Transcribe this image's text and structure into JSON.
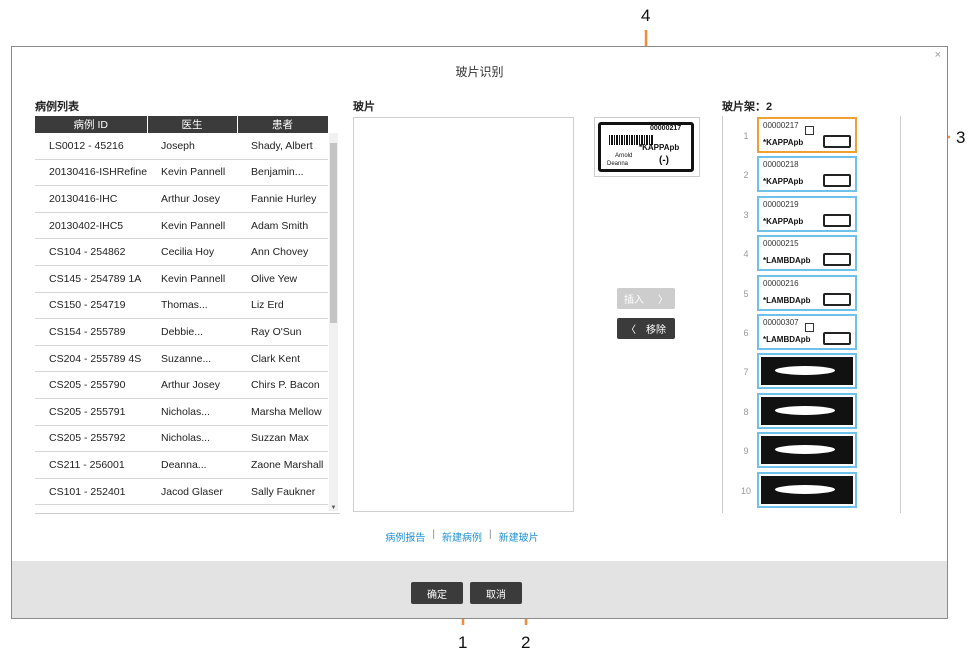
{
  "dialog": {
    "title": "玻片识别",
    "close": "×"
  },
  "case_list": {
    "label": "病例列表",
    "headers": [
      "病例 ID",
      "医生",
      "患者"
    ],
    "rows": [
      [
        "LS0012 - 45216",
        "Joseph",
        "Shady, Albert"
      ],
      [
        "20130416-ISHRefine",
        "Kevin Pannell",
        "Benjamin..."
      ],
      [
        "20130416-IHC",
        "Arthur Josey",
        "Fannie Hurley"
      ],
      [
        "20130402-IHC5",
        "Kevin Pannell",
        "Adam Smith"
      ],
      [
        "CS104 - 254862",
        "Cecilia Hoy",
        "Ann Chovey"
      ],
      [
        "CS145 - 254789 1A",
        "Kevin Pannell",
        "Olive Yew"
      ],
      [
        "CS150 - 254719",
        "Thomas...",
        "Liz Erd"
      ],
      [
        "CS154 - 255789",
        "Debbie...",
        "Ray O'Sun"
      ],
      [
        "CS204 - 255789 4S",
        "Suzanne...",
        "Clark Kent"
      ],
      [
        "CS205 - 255790",
        "Arthur Josey",
        "Chirs P. Bacon"
      ],
      [
        "CS205 - 255791",
        "Nicholas...",
        "Marsha Mellow"
      ],
      [
        "CS205 - 255792",
        "Nicholas...",
        "Suzzan Max"
      ],
      [
        "CS211 - 256001",
        "Deanna...",
        "Zaone Marshall"
      ],
      [
        "CS101 - 252401",
        "Jacod Glaser",
        "Sally Faukner"
      ]
    ]
  },
  "slides": {
    "label": "玻片"
  },
  "label_image": {
    "line1": "00000217",
    "line2": "*KAPPApb",
    "line3": "Arnold",
    "line4": "Deanna",
    "mark": "(-)"
  },
  "buttons": {
    "insert": "插入",
    "remove": "移除",
    "ok": "确定",
    "cancel": "取消"
  },
  "rack": {
    "label": "玻片架：2",
    "slots": [
      {
        "num": "1",
        "id": "00000217",
        "name": "*KAPPApb",
        "qr": true,
        "selected": true
      },
      {
        "num": "2",
        "id": "00000218",
        "name": "*KAPPApb",
        "qr": false,
        "selected": false
      },
      {
        "num": "3",
        "id": "00000219",
        "name": "*KAPPApb",
        "qr": false,
        "selected": false
      },
      {
        "num": "4",
        "id": "00000215",
        "name": "*LAMBDApb",
        "qr": false,
        "selected": false
      },
      {
        "num": "5",
        "id": "00000216",
        "name": "*LAMBDApb",
        "qr": false,
        "selected": false
      },
      {
        "num": "6",
        "id": "00000307",
        "name": "*LAMBDApb",
        "qr": true,
        "selected": false
      },
      {
        "num": "7",
        "id": "",
        "name": "",
        "dark": true
      },
      {
        "num": "8",
        "id": "",
        "name": "",
        "dark": true
      },
      {
        "num": "9",
        "id": "",
        "name": "",
        "dark": true
      },
      {
        "num": "10",
        "id": "",
        "name": "",
        "dark": true
      }
    ]
  },
  "links": {
    "case_report": "病例报告",
    "new_case": "新建病例",
    "new_slide": "新建玻片",
    "separator": "|"
  },
  "callouts": {
    "c1": "1",
    "c2": "2",
    "c3": "3",
    "c4": "4"
  },
  "colors": {
    "accent": "#1e90d6",
    "arrow": "#f08c3c",
    "slot_border": "#6fc0ea",
    "dark_button": "#3b3b3b"
  }
}
